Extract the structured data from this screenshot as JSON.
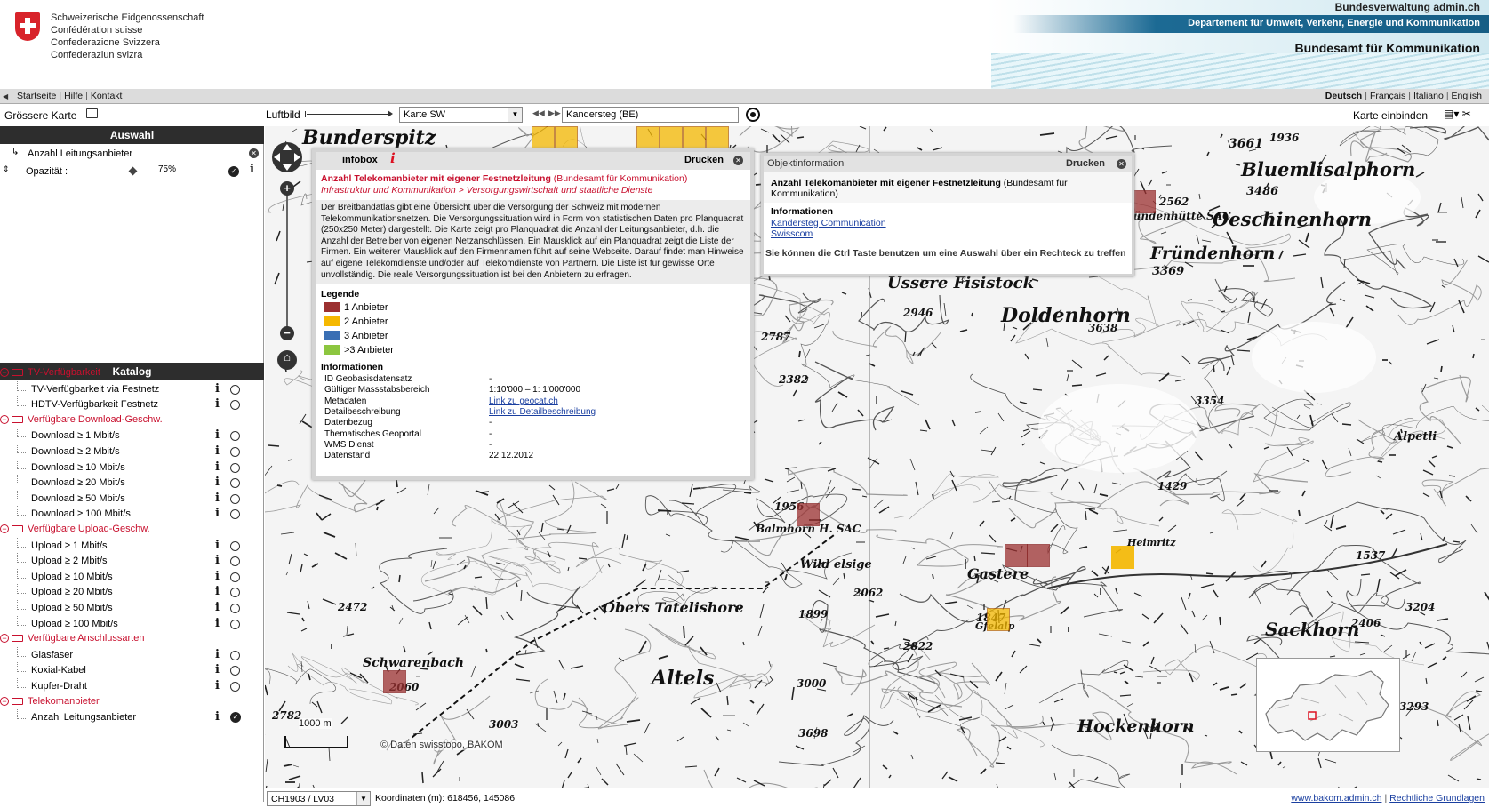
{
  "header": {
    "confederation": [
      "Schweizerische Eidgenossenschaft",
      "Confédération suisse",
      "Confederazione Svizzera",
      "Confederaziun svizra"
    ],
    "top_right": "Bundesverwaltung admin.ch",
    "department": "Departement für Umwelt, Verkehr, Energie und Kommunikation",
    "office": "Bundesamt für Kommunikation"
  },
  "nav": {
    "links": [
      "Startseite",
      "Hilfe",
      "Kontakt"
    ],
    "languages": [
      "Deutsch",
      "Français",
      "Italiano",
      "English"
    ]
  },
  "toolbar": {
    "bigger_map": "Grössere Karte",
    "aerial": "Luftbild",
    "map_select": "Karte SW",
    "location": "Kandersteg (BE)",
    "embed": "Karte einbinden"
  },
  "selection": {
    "title": "Auswahl",
    "layer": "Anzahl Leitungsanbieter",
    "opacity_label": "Opazität :",
    "opacity_value": "75%",
    "opacity": 0.75
  },
  "catalog": {
    "title": "Katalog",
    "groups": [
      {
        "label": "TV-Verfügbarkeit",
        "items": [
          "TV-Verfügbarkeit via Festnetz",
          "HDTV-Verfügbarkeit Festnetz"
        ]
      },
      {
        "label": "Verfügbare Download-Geschw.",
        "items": [
          "Download ≥ 1 Mbit/s",
          "Download ≥ 2 Mbit/s",
          "Download ≥ 10 Mbit/s",
          "Download ≥ 20 Mbit/s",
          "Download ≥ 50 Mbit/s",
          "Download ≥ 100 Mbit/s"
        ]
      },
      {
        "label": "Verfügbare Upload-Geschw.",
        "items": [
          "Upload ≥ 1 Mbit/s",
          "Upload ≥ 2 Mbit/s",
          "Upload ≥ 10 Mbit/s",
          "Upload ≥ 20 Mbit/s",
          "Upload ≥ 50 Mbit/s",
          "Upload ≥ 100 Mbit/s"
        ]
      },
      {
        "label": "Verfügbare Anschlussarten",
        "items": [
          "Glasfaser",
          "Koxial-Kabel",
          "Kupfer-Draht"
        ]
      },
      {
        "label": "Telekomanbieter",
        "items": [
          "Anzahl Leitungsanbieter"
        ]
      }
    ],
    "selected": "Anzahl Leitungsanbieter"
  },
  "infobox": {
    "title": "infobox",
    "print": "Drucken",
    "layer_title": "Anzahl Telekomanbieter mit eigener Festnetzleitung",
    "source": "(Bundesamt für Kommunikation)",
    "path": "Infrastruktur und Kommunikation > Versorgungswirtschaft und staatliche Dienste",
    "description": "Der Breitbandatlas gibt eine Übersicht über die Versorgung der Schweiz mit modernen Telekommunikationsnetzen. Die Versorgungssituation wird in Form von statistischen Daten pro Planquadrat (250x250 Meter) dargestellt. Die Karte zeigt pro Planquadrat die Anzahl der Leitungsanbieter, d.h. die Anzahl der Betreiber von eigenen Netzanschlüssen. Ein Mausklick auf ein Planquadrat zeigt die Liste der Firmen. Ein weiterer Mausklick auf den Firmennamen führt auf seine Webseite. Darauf findet man Hinweise auf eigene Telekomdienste und/oder auf Telekomdienste von Partnern. Die Liste ist für gewisse Orte unvollständig. Die reale Versorgungssituation ist bei den Anbietern zu erfragen.",
    "legend_title": "Legende",
    "legend": [
      {
        "label": "1 Anbieter",
        "color": "#9b3030"
      },
      {
        "label": "2 Anbieter",
        "color": "#f5b800"
      },
      {
        "label": "3 Anbieter",
        "color": "#3a6fb4"
      },
      {
        "label": ">3 Anbieter",
        "color": "#8cc63f"
      }
    ],
    "info_title": "Informationen",
    "info": [
      {
        "k": "ID Geobasisdatensatz",
        "v": "-"
      },
      {
        "k": "Gültiger Massstabsbereich",
        "v": "1:10'000 – 1: 1'000'000"
      },
      {
        "k": "Metadaten",
        "v": "Link zu geocat.ch",
        "link": true
      },
      {
        "k": "Detailbeschreibung",
        "v": "Link zu Detailbeschreibung",
        "link": true
      },
      {
        "k": "Datenbezug",
        "v": "-"
      },
      {
        "k": "Thematisches Geoportal",
        "v": "-"
      },
      {
        "k": "WMS Dienst",
        "v": "-"
      },
      {
        "k": "Datenstand",
        "v": "22.12.2012"
      }
    ]
  },
  "objinfo": {
    "title": "Objektinformation",
    "print": "Drucken",
    "layer_title": "Anzahl Telekomanbieter mit eigener Festnetzleitung",
    "source": "(Bundesamt für Kommunikation)",
    "info_title": "Informationen",
    "providers": [
      "Kandersteg Communication",
      "Swisscom"
    ],
    "hint": "Sie können die Ctrl Taste benutzen um eine Auswahl über ein Rechteck zu treffen"
  },
  "map": {
    "labels": [
      "Bunderspitz",
      "Bluemlisalphorn",
      "Oeschinenhorn",
      "Fründenhorn",
      "Üssere Fisistock",
      "Doldenhorn",
      "Balmhorn H. SAC",
      "Gastere",
      "Heimritz",
      "Obers Tatelishore",
      "Altels",
      "Schwarenbach",
      "Sackhorn",
      "Hockenhorn",
      "Alpetli",
      "Wild elsige",
      "Gfelalp",
      "Fründenhütte SAC",
      "3661",
      "3486",
      "3369",
      "1936",
      "2946",
      "3638",
      "2787",
      "2382",
      "3354",
      "1429",
      "1956",
      "1537",
      "1847",
      "2062",
      "1899",
      "2472",
      "2822",
      "2060",
      "3000",
      "2782",
      "3698",
      "3003",
      "3293",
      "3204",
      "2406",
      "2562"
    ],
    "scale_label": "1000 m",
    "credit": "© Daten swisstopo, BAKOM"
  },
  "footer": {
    "crs": "CH1903 / LV03",
    "coords": "Koordinaten (m): 618456, 145086",
    "links": [
      "www.bakom.admin.ch",
      "Rechtliche Grundlagen"
    ]
  }
}
